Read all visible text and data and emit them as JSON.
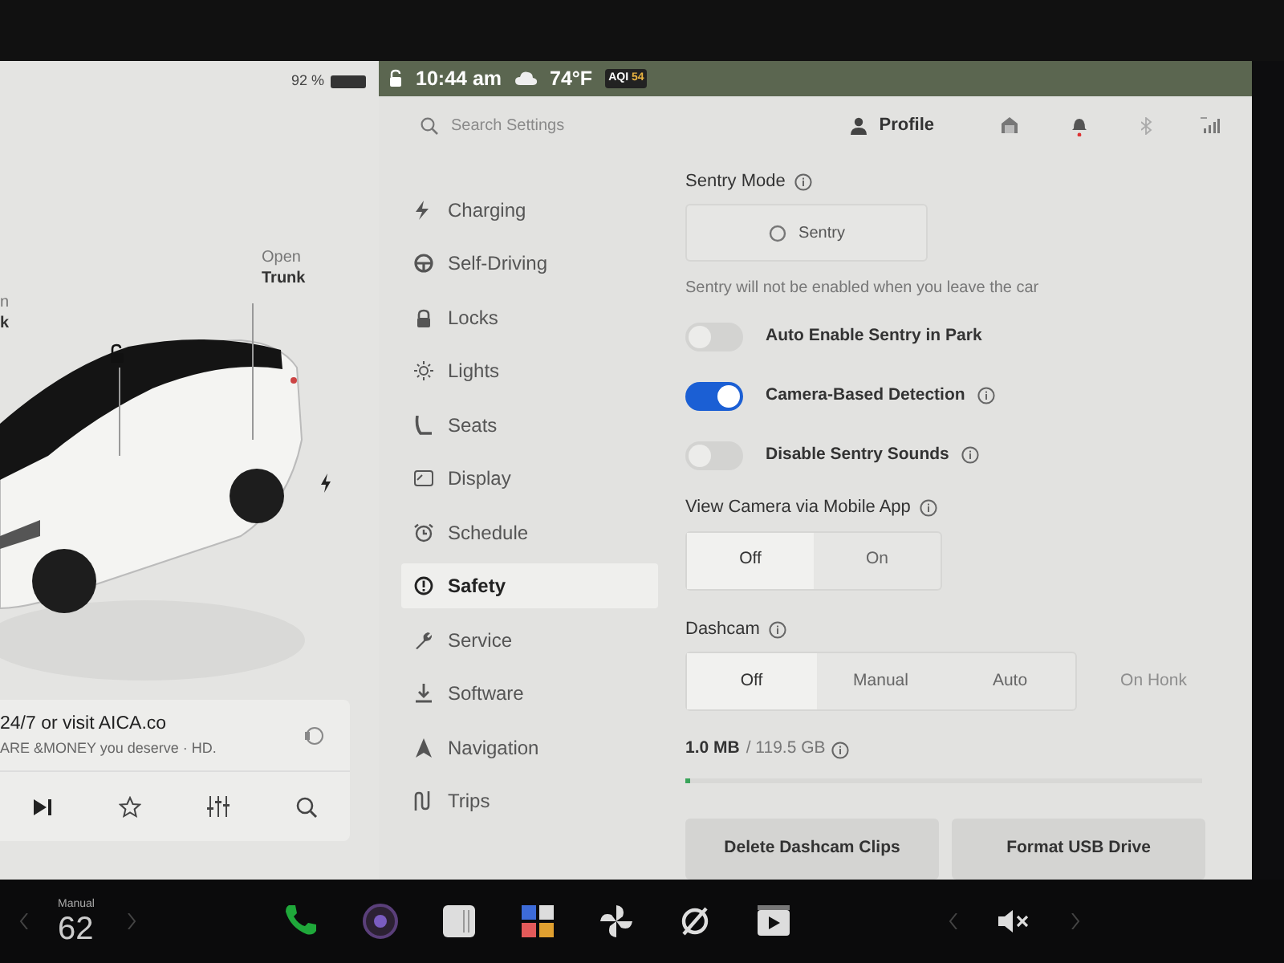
{
  "car_panel": {
    "battery": "92 %",
    "frunk_label": {
      "line1": "n",
      "line2": "k"
    },
    "trunk_label": {
      "line1": "Open",
      "line2": "Trunk"
    }
  },
  "media": {
    "title": "24/7 or visit AICA.co",
    "subtitle": "ARE &MONEY you deserve · HD."
  },
  "status_bar": {
    "time": "10:44 am",
    "temperature": "74°F",
    "aqi_label": "AQI",
    "aqi_value": "54"
  },
  "header": {
    "search": {
      "placeholder": "Search Settings"
    },
    "profile": "Profile"
  },
  "sidebar": {
    "items": [
      {
        "label": "Charging",
        "selected": false
      },
      {
        "label": "Self-Driving",
        "selected": false
      },
      {
        "label": "Locks",
        "selected": false
      },
      {
        "label": "Lights",
        "selected": false
      },
      {
        "label": "Seats",
        "selected": false
      },
      {
        "label": "Display",
        "selected": false
      },
      {
        "label": "Schedule",
        "selected": false
      },
      {
        "label": "Safety",
        "selected": true
      },
      {
        "label": "Service",
        "selected": false
      },
      {
        "label": "Software",
        "selected": false
      },
      {
        "label": "Navigation",
        "selected": false
      },
      {
        "label": "Trips",
        "selected": false
      }
    ]
  },
  "sentry": {
    "title": "Sentry Mode",
    "button": "Sentry",
    "note": "Sentry will not be enabled when you leave the car",
    "toggles": [
      {
        "label": "Auto Enable Sentry in Park",
        "on": false,
        "info": false
      },
      {
        "label": "Camera-Based Detection",
        "on": true,
        "info": true
      },
      {
        "label": "Disable Sentry Sounds",
        "on": false,
        "info": true
      }
    ]
  },
  "view_camera": {
    "title": "View Camera via Mobile App",
    "options": [
      {
        "label": "Off",
        "selected": true
      },
      {
        "label": "On",
        "selected": false
      }
    ]
  },
  "dashcam": {
    "title": "Dashcam",
    "options": [
      {
        "label": "Off",
        "selected": true,
        "disabled": false
      },
      {
        "label": "Manual",
        "selected": false,
        "disabled": false
      },
      {
        "label": "Auto",
        "selected": false,
        "disabled": false
      },
      {
        "label": "On Honk",
        "selected": false,
        "disabled": true
      }
    ]
  },
  "storage": {
    "used": "1.0 MB",
    "total": "/ 119.5 GB",
    "level": 0.01
  },
  "buttons": [
    "Delete Dashcam Clips",
    "Format USB Drive"
  ],
  "dock": {
    "climate_mode": "Manual",
    "temperature": "62"
  }
}
